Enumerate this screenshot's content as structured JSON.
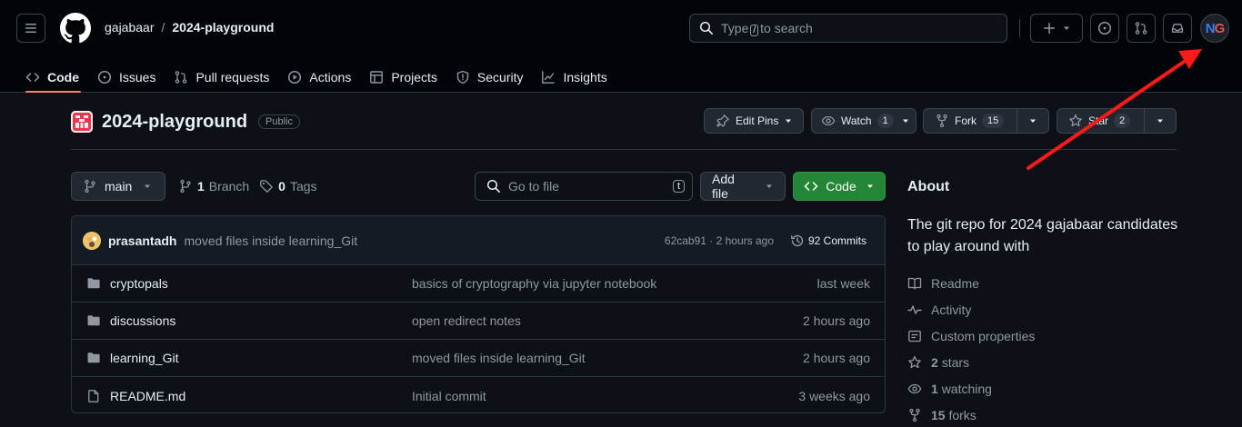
{
  "header": {
    "owner": "gajabaar",
    "separator": "/",
    "repo": "2024-playground",
    "search": {
      "prefix": "Type",
      "key": "/",
      "suffix": "to search"
    },
    "avatar": {
      "letter1": "N",
      "letter2": "G"
    }
  },
  "nav": {
    "items": [
      {
        "label": "Code",
        "icon": "code-icon"
      },
      {
        "label": "Issues",
        "icon": "issue-opened-icon"
      },
      {
        "label": "Pull requests",
        "icon": "git-pull-request-icon"
      },
      {
        "label": "Actions",
        "icon": "play-icon"
      },
      {
        "label": "Projects",
        "icon": "table-icon"
      },
      {
        "label": "Security",
        "icon": "shield-icon"
      },
      {
        "label": "Insights",
        "icon": "graph-icon"
      }
    ]
  },
  "repo": {
    "name": "2024-playground",
    "visibility": "Public",
    "edit_pins": "Edit Pins",
    "watch": {
      "label": "Watch",
      "count": "1"
    },
    "fork": {
      "label": "Fork",
      "count": "15"
    },
    "star": {
      "label": "Star",
      "count": "2"
    }
  },
  "toolbar": {
    "branch": "main",
    "branches": {
      "count": "1",
      "label": "Branch"
    },
    "tags": {
      "count": "0",
      "label": "Tags"
    },
    "goto_placeholder": "Go to file",
    "goto_key": "t",
    "add_file": "Add file",
    "code": "Code"
  },
  "commit": {
    "author": "prasantadh",
    "message": "moved files inside learning_Git",
    "meta": "62cab91 · 2 hours ago",
    "commits": "92 Commits"
  },
  "files": [
    {
      "type": "folder",
      "name": "cryptopals",
      "message": "basics of cryptography via jupyter notebook",
      "date": "last week"
    },
    {
      "type": "folder",
      "name": "discussions",
      "message": "open redirect notes",
      "date": "2 hours ago"
    },
    {
      "type": "folder",
      "name": "learning_Git",
      "message": "moved files inside learning_Git",
      "date": "2 hours ago"
    },
    {
      "type": "file",
      "name": "README.md",
      "message": "Initial commit",
      "date": "3 weeks ago"
    }
  ],
  "about": {
    "heading": "About",
    "description": "The git repo for 2024 gajabaar candidates to play around with",
    "readme": "Readme",
    "activity": "Activity",
    "custom_properties": "Custom properties",
    "stars": {
      "count": "2",
      "label": "stars"
    },
    "watching": {
      "count": "1",
      "label": "watching"
    },
    "forks": {
      "count": "15",
      "label": "forks"
    }
  },
  "colors": {
    "bg": "#0d1117",
    "header_bg": "#010409",
    "border": "#30363d",
    "accent_tab": "#f78166",
    "primary_button": "#238636",
    "annotation_arrow": "#ff1a1a"
  }
}
